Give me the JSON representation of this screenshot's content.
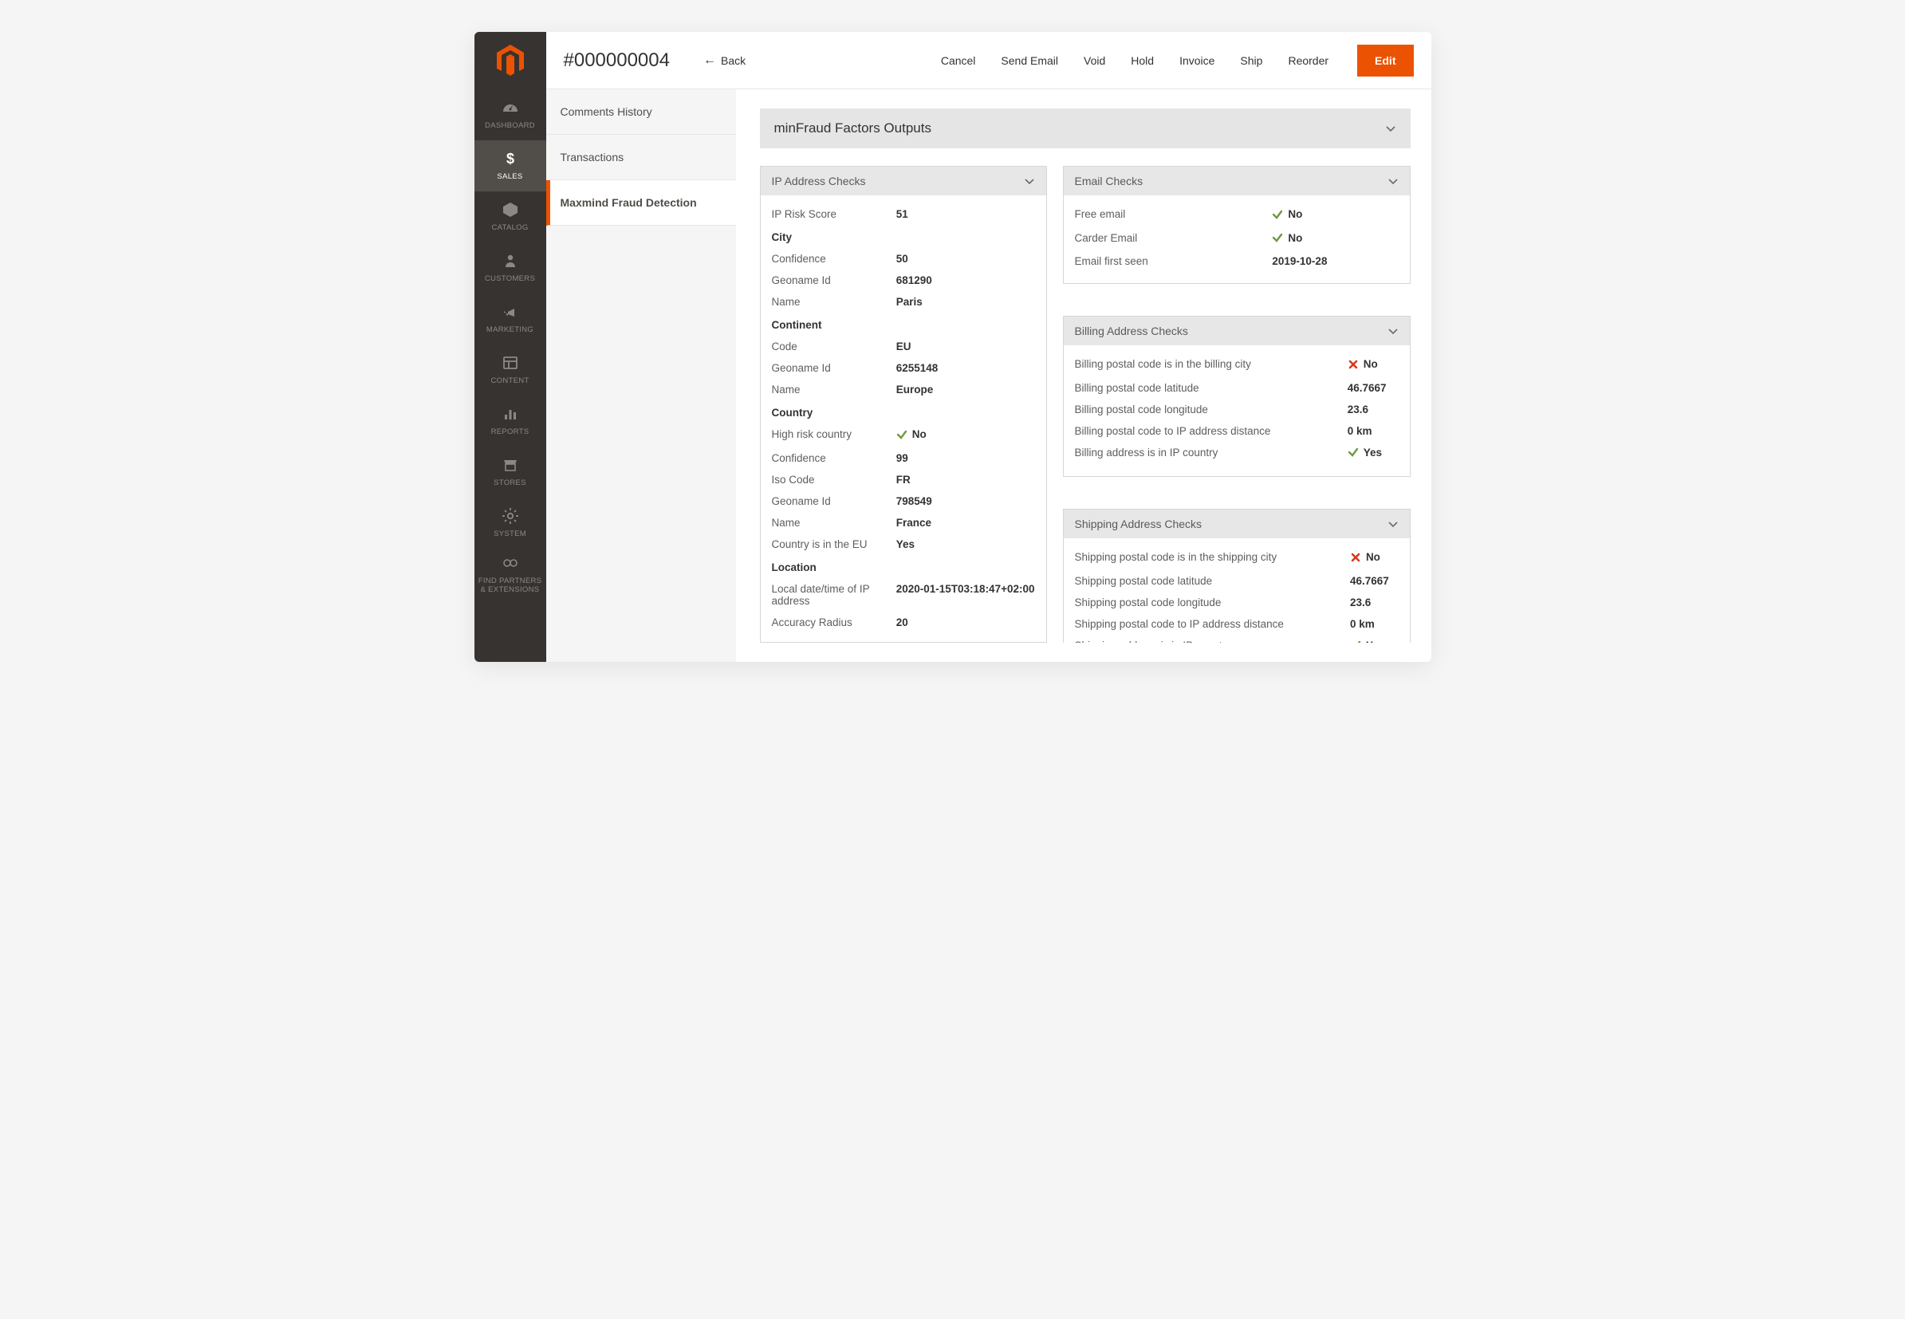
{
  "nav": [
    {
      "label": "DASHBOARD",
      "icon": "gauge"
    },
    {
      "label": "SALES",
      "icon": "dollar"
    },
    {
      "label": "CATALOG",
      "icon": "package"
    },
    {
      "label": "CUSTOMERS",
      "icon": "person"
    },
    {
      "label": "MARKETING",
      "icon": "megaphone"
    },
    {
      "label": "CONTENT",
      "icon": "layout"
    },
    {
      "label": "REPORTS",
      "icon": "bar"
    },
    {
      "label": "STORES",
      "icon": "storefront"
    },
    {
      "label": "SYSTEM",
      "icon": "gear"
    },
    {
      "label": "FIND PARTNERS & EXTENSIONS",
      "icon": "partners"
    }
  ],
  "nav_active_index": 1,
  "header": {
    "title": "#000000004",
    "back": "Back",
    "cancel": "Cancel",
    "send_email": "Send Email",
    "void": "Void",
    "hold": "Hold",
    "invoice": "Invoice",
    "ship": "Ship",
    "reorder": "Reorder",
    "edit": "Edit"
  },
  "tabs": {
    "items": [
      "Comments History",
      "Transactions",
      "Maxmind Fraud Detection"
    ],
    "active_index": 2
  },
  "section_title": "minFraud Factors Outputs",
  "panel_ip": {
    "title": "IP Address Checks",
    "rows": [
      {
        "k": "IP Risk Score",
        "v": "51"
      },
      {
        "group": "City"
      },
      {
        "k": "Confidence",
        "v": "50"
      },
      {
        "k": "Geoname Id",
        "v": "681290"
      },
      {
        "k": "Name",
        "v": "Paris"
      },
      {
        "group": "Continent"
      },
      {
        "k": "Code",
        "v": "EU"
      },
      {
        "k": "Geoname Id",
        "v": "6255148"
      },
      {
        "k": "Name",
        "v": "Europe"
      },
      {
        "group": "Country"
      },
      {
        "k": "High risk country",
        "v": "No",
        "check": "ok"
      },
      {
        "k": "Confidence",
        "v": "99"
      },
      {
        "k": "Iso Code",
        "v": "FR"
      },
      {
        "k": "Geoname Id",
        "v": "798549"
      },
      {
        "k": "Name",
        "v": "France"
      },
      {
        "k": "Country is in the EU",
        "v": "Yes"
      },
      {
        "group": "Location"
      },
      {
        "k": "Local date/time of IP address",
        "v": "2020-01-15T03:18:47+02:00"
      },
      {
        "k": "Accuracy Radius",
        "v": "20"
      }
    ]
  },
  "panel_email": {
    "title": "Email Checks",
    "rows": [
      {
        "k": "Free email",
        "v": "No",
        "check": "ok"
      },
      {
        "k": "Carder Email",
        "v": "No",
        "check": "ok"
      },
      {
        "k": "Email first seen",
        "v": "2019-10-28"
      }
    ]
  },
  "panel_billing": {
    "title": "Billing Address Checks",
    "rows": [
      {
        "k": "Billing postal code is in the billing city",
        "v": "No",
        "check": "bad"
      },
      {
        "k": "Billing postal code latitude",
        "v": "46.7667"
      },
      {
        "k": "Billing postal code longitude",
        "v": "23.6"
      },
      {
        "k": "Billing postal code to IP address distance",
        "v": "0 km"
      },
      {
        "k": "Billing address is in IP country",
        "v": "Yes",
        "check": "ok"
      }
    ]
  },
  "panel_shipping": {
    "title": "Shipping Address Checks",
    "rows": [
      {
        "k": "Shipping postal code is in the shipping city",
        "v": "No",
        "check": "bad"
      },
      {
        "k": "Shipping postal code latitude",
        "v": "46.7667"
      },
      {
        "k": "Shipping postal code longitude",
        "v": "23.6"
      },
      {
        "k": "Shipping postal code to IP address distance",
        "v": "0 km"
      },
      {
        "k": "Shipping address is in IP country",
        "v": "Yes",
        "check": "ok"
      }
    ]
  }
}
